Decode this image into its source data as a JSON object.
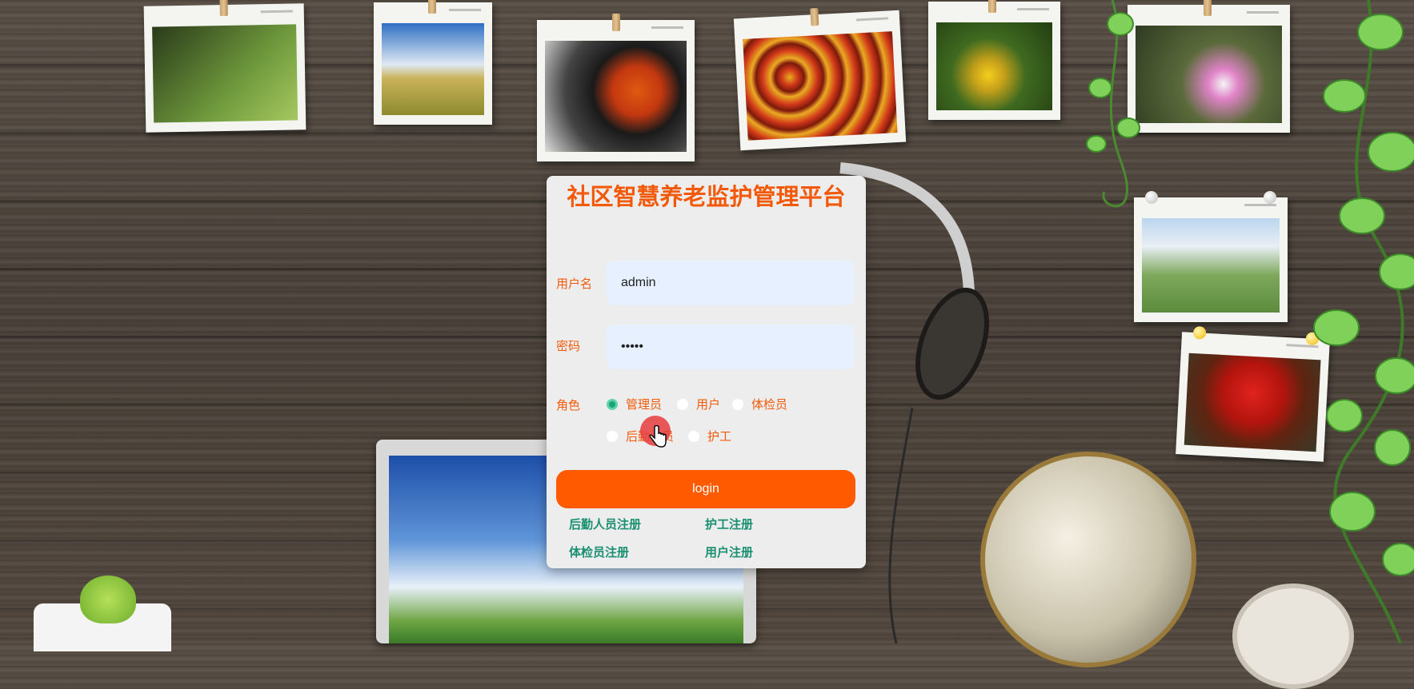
{
  "login": {
    "title": "社区智慧养老监护管理平台",
    "username_label": "用户名",
    "username_value": "admin",
    "password_label": "密码",
    "password_value": "•••••",
    "role_label": "角色",
    "roles": [
      {
        "label": "管理员",
        "selected": true
      },
      {
        "label": "用户",
        "selected": false
      },
      {
        "label": "体检员",
        "selected": false
      },
      {
        "label": "后勤人员",
        "selected": false
      },
      {
        "label": "护工",
        "selected": false
      }
    ],
    "login_button": "login",
    "links": [
      "后勤人员注册",
      "护工注册",
      "体检员注册",
      "用户注册"
    ]
  },
  "colors": {
    "accent": "#ff5a00",
    "title": "#f25a0a",
    "link": "#1a9070",
    "radio_selected": "#1aa37a",
    "input_bg": "#e6f0fe"
  },
  "icons": [
    "hand-pointer-icon"
  ]
}
